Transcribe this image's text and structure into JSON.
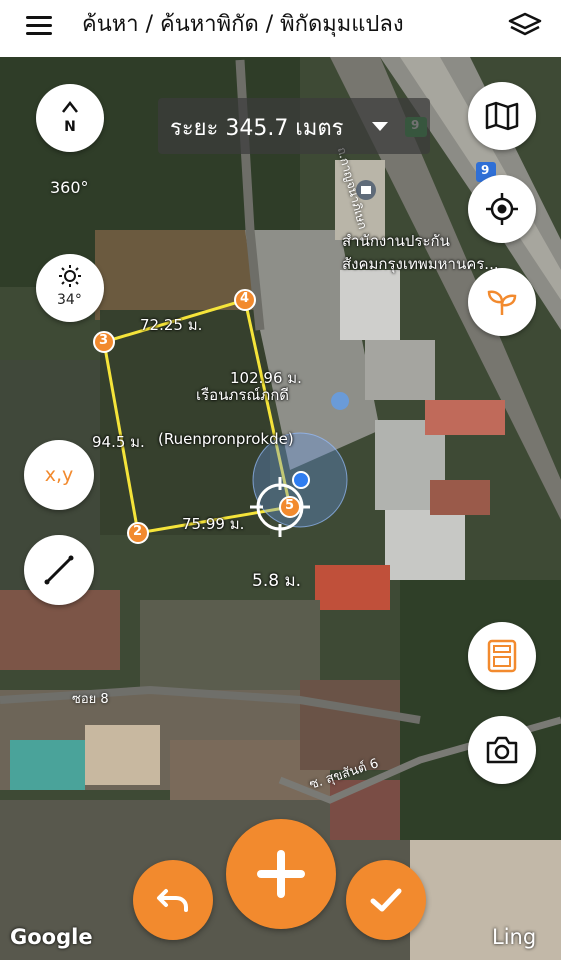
{
  "header": {
    "title": "ค้นหา / ค้นหาพิกัด / พิกัดมุมแปลง",
    "menu_icon": "hamburger-icon",
    "layers_icon": "layers-icon"
  },
  "measurement": {
    "total_label": "ระยะ 345.7 เมตร",
    "segments": [
      "72.25 ม.",
      "102.96 ม.",
      "75.99 ม.",
      "94.5 ม."
    ],
    "vertices": [
      "2",
      "3",
      "4",
      "5"
    ],
    "cursor_offset": "5.8 ม.",
    "line_color": "#f5e43a",
    "vertex_color": "#f28a2e"
  },
  "left_controls": {
    "compass_label": "360°",
    "compass_icon": "north-arrow-icon",
    "sun_value": "34°",
    "sun_icon": "sun-icon",
    "coords_label": "x,y",
    "line_icon": "ruler-line-icon"
  },
  "right_controls": {
    "map_icon": "map-icon",
    "locate_icon": "crosshair-locate-icon",
    "plant_icon": "sprout-icon",
    "calculator_icon": "calculator-icon",
    "camera_icon": "camera-icon"
  },
  "bottom_controls": {
    "undo_icon": "undo-icon",
    "add_icon": "plus-icon",
    "confirm_icon": "check-icon"
  },
  "map_labels": {
    "poi_thai_1": "สำนักงานประกัน",
    "poi_thai_2": "สังคมกรุงเทพมหานคร...",
    "place_thai": "เรือนภรณ์ภกดี",
    "place_latin": "(Ruenpronprokde)",
    "soi_8": "ซอย 8",
    "soi_sukhumvit": "ซ. สุขสันต์ 6",
    "road_vertical": "ถ.กาญจนาภิเษก",
    "route_badge_1": "9",
    "route_badge_2": "9",
    "google": "Google",
    "ling": "Ling"
  },
  "colors": {
    "accent": "#f28a2e",
    "button_bg": "#ffffff",
    "polygon_line": "#f5e43a",
    "location_dot": "#2f7df0"
  }
}
